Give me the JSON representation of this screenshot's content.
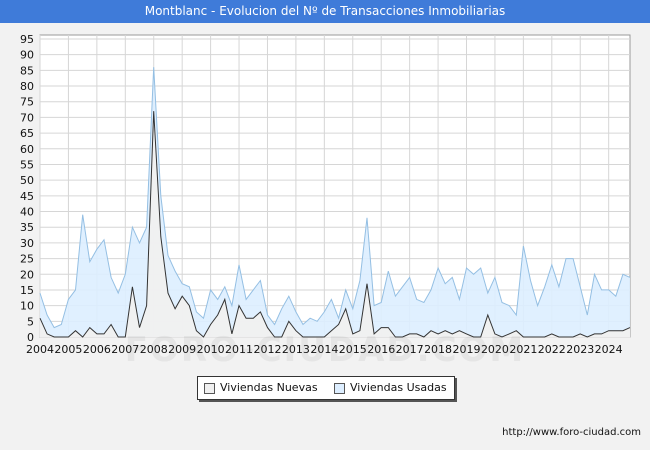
{
  "page": {
    "title": "Montblanc - Evolucion del Nº de Transacciones Inmobiliarias",
    "url": "http://www.foro-ciudad.com",
    "watermark": "FORO-CIUDAD.COM"
  },
  "colors": {
    "title_bg": "#3f7bd9",
    "usadas_fill": "#ddeeff",
    "usadas_line": "#94bfe3",
    "nuevas_fill": "#f0f0f0",
    "nuevas_line": "#333333",
    "grid": "#d6d6d6"
  },
  "legend": {
    "nuevas": "Viviendas Nuevas",
    "usadas": "Viviendas Usadas"
  },
  "chart_data": {
    "type": "area",
    "title": "Montblanc - Evolucion del Nº de Transacciones Inmobiliarias",
    "xlabel": "",
    "ylabel": "",
    "x_ticks": [
      "2004",
      "2005",
      "2006",
      "2007",
      "2008",
      "2009",
      "2010",
      "2011",
      "2012",
      "2013",
      "2014",
      "2015",
      "2016",
      "2017",
      "2018",
      "2019",
      "2020",
      "2021",
      "2022",
      "2023",
      "2024"
    ],
    "x_range": [
      2004.0,
      2024.75
    ],
    "y_ticks": [
      0,
      5,
      10,
      15,
      20,
      25,
      30,
      35,
      40,
      45,
      50,
      55,
      60,
      65,
      70,
      75,
      80,
      85,
      90,
      95
    ],
    "ylim": [
      0,
      95
    ],
    "grid": true,
    "legend_position": "bottom",
    "x": [
      2004.0,
      2004.25,
      2004.5,
      2004.75,
      2005.0,
      2005.25,
      2005.5,
      2005.75,
      2006.0,
      2006.25,
      2006.5,
      2006.75,
      2007.0,
      2007.25,
      2007.5,
      2007.75,
      2008.0,
      2008.25,
      2008.5,
      2008.75,
      2009.0,
      2009.25,
      2009.5,
      2009.75,
      2010.0,
      2010.25,
      2010.5,
      2010.75,
      2011.0,
      2011.25,
      2011.5,
      2011.75,
      2012.0,
      2012.25,
      2012.5,
      2012.75,
      2013.0,
      2013.25,
      2013.5,
      2013.75,
      2014.0,
      2014.25,
      2014.5,
      2014.75,
      2015.0,
      2015.25,
      2015.5,
      2015.75,
      2016.0,
      2016.25,
      2016.5,
      2016.75,
      2017.0,
      2017.25,
      2017.5,
      2017.75,
      2018.0,
      2018.25,
      2018.5,
      2018.75,
      2019.0,
      2019.25,
      2019.5,
      2019.75,
      2020.0,
      2020.25,
      2020.5,
      2020.75,
      2021.0,
      2021.25,
      2021.5,
      2021.75,
      2022.0,
      2022.25,
      2022.5,
      2022.75,
      2023.0,
      2023.25,
      2023.5,
      2023.75,
      2024.0,
      2024.25,
      2024.5,
      2024.75
    ],
    "series": [
      {
        "name": "Viviendas Usadas",
        "values": [
          14,
          7,
          3,
          4,
          12,
          15,
          39,
          24,
          28,
          31,
          19,
          14,
          20,
          35,
          30,
          35,
          86,
          45,
          26,
          21,
          17,
          16,
          8,
          6,
          15,
          12,
          16,
          10,
          23,
          12,
          15,
          18,
          7,
          4,
          9,
          13,
          8,
          4,
          6,
          5,
          8,
          12,
          6,
          15,
          9,
          18,
          38,
          10,
          11,
          21,
          13,
          16,
          19,
          12,
          11,
          15,
          22,
          17,
          19,
          12,
          22,
          20,
          22,
          14,
          19,
          11,
          10,
          7,
          29,
          18,
          10,
          16,
          23,
          16,
          25,
          25,
          16,
          7,
          20,
          15,
          15,
          13,
          20,
          19
        ]
      },
      {
        "name": "Viviendas Nuevas",
        "values": [
          6,
          1,
          0,
          0,
          0,
          2,
          0,
          3,
          1,
          1,
          4,
          0,
          0,
          16,
          3,
          10,
          72,
          32,
          14,
          9,
          13,
          10,
          2,
          0,
          4,
          7,
          12,
          1,
          10,
          6,
          6,
          8,
          3,
          0,
          0,
          5,
          2,
          0,
          0,
          0,
          0,
          2,
          4,
          9,
          1,
          2,
          17,
          1,
          3,
          3,
          0,
          0,
          1,
          1,
          0,
          2,
          1,
          2,
          1,
          2,
          1,
          0,
          0,
          7,
          1,
          0,
          1,
          2,
          0,
          0,
          0,
          0,
          1,
          0,
          0,
          0,
          1,
          0,
          1,
          1,
          2,
          2,
          2,
          3
        ]
      }
    ]
  }
}
